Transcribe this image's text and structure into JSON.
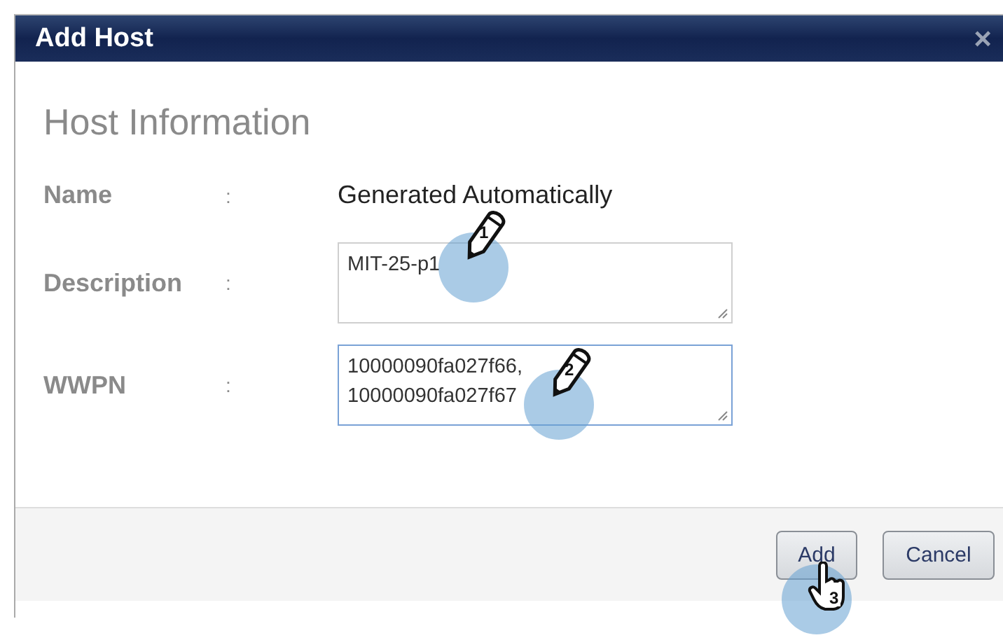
{
  "dialog": {
    "title": "Add Host",
    "close": "×"
  },
  "section_title": "Host Information",
  "fields": [
    {
      "label": "Name",
      "separator": ":",
      "kind": "text",
      "value": "Generated Automatically"
    },
    {
      "label": "Description",
      "separator": ":",
      "kind": "textarea",
      "value": "MIT-25-p1",
      "focused": false,
      "step": "1"
    },
    {
      "label": "WWPN",
      "separator": ":",
      "kind": "textarea",
      "value": "10000090fa027f66,\n10000090fa027f67",
      "focused": true,
      "step": "2"
    }
  ],
  "buttons": [
    {
      "label": "Add",
      "step": "3"
    },
    {
      "label": "Cancel"
    }
  ]
}
